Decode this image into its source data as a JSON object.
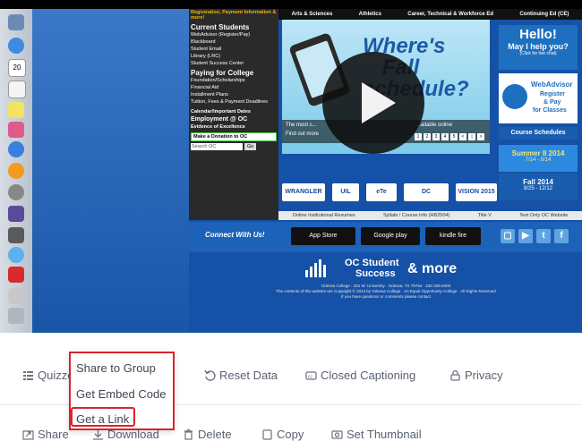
{
  "video": {
    "site_menu": {
      "top_label": "Registration, Payment Information & more!",
      "current_students": "Current Students",
      "items": [
        "WebAdvisor (Register/Pay)",
        "Blackboard",
        "Student Email",
        "Library (LRC)",
        "Student Success Center"
      ],
      "paying": "Paying for College",
      "paying_items": [
        "Foundation/Scholarships",
        "Financial Aid",
        "Installment Plans",
        "Tuition, Fees & Payment Deadlines"
      ],
      "more_items": [
        "Calendar/Important Dates",
        "Employment @ OC",
        "Evidence of Excellence"
      ],
      "donation": "Make a Donation to OC",
      "search_placeholder": "Search OC",
      "go": "Go"
    },
    "topnav": [
      "Arts & Sciences",
      "Athletics",
      "Career, Technical & Workforce Ed",
      "Continuing Ed (CE)"
    ],
    "hero": {
      "title_line1": "Where's",
      "title_line2": "Fall",
      "title_line3": "schedule?",
      "bar_text1": "The most c...",
      "bar_text2": "Find out more",
      "bar_text3": "...ailable online",
      "dots": [
        "1",
        "2",
        "3",
        "4",
        "5",
        "<",
        "|",
        ">"
      ]
    },
    "widgets": {
      "hello": "Hello!",
      "may_i_help": "May I help you?",
      "click_chat": "(Click for live chat)",
      "webadvisor": "WebAdvisor",
      "register": "Register",
      "pay": "& Pay",
      "for_classes": "for Classes",
      "course_schedules": "Course Schedules",
      "summer": "Summer II 2014",
      "summer_dates": "7/14 - 8/14",
      "fall": "Fall 2014",
      "fall_dates": "8/25 - 12/12"
    },
    "logos": [
      "WRANGLER EXPRESS",
      "UIL",
      "eTe",
      "DC",
      "VISION 2015"
    ],
    "link_row": [
      "Online Institutional Resumes",
      "Syllabi / Course Info (HB2504)",
      "Title V",
      "Text Only OC Website"
    ],
    "connect": {
      "title": "Connect With Us!",
      "app_store": "App Store",
      "google_play": "Google play",
      "kindle": "kindle fire"
    },
    "success": {
      "line1": "OC Student",
      "line2": "Success",
      "amp": "& more"
    },
    "footer": {
      "line1": "Odessa College · 201 W. University · Odessa, TX 79764 · 432-335-6400",
      "line2": "The contents of this website are Copyright © 2014 by Odessa College · An Equal Opportunity College · All Rights Reserved",
      "line3": "If you have questions or comments please contact"
    }
  },
  "toolbar": {
    "quizzes": "Quizzes",
    "reset_data": "Reset Data",
    "closed_captioning": "Closed Captioning",
    "privacy": "Privacy"
  },
  "actions": {
    "share": "Share",
    "download": "Download",
    "delete": "Delete",
    "copy": "Copy",
    "set_thumbnail": "Set Thumbnail"
  },
  "popup": {
    "share_to_group": "Share to Group",
    "get_embed_code": "Get Embed Code",
    "get_a_link": "Get a Link"
  },
  "colors": {
    "highlight": "#d9232d",
    "toolbar_text": "#5a6270",
    "site_blue": "#1551a6"
  }
}
